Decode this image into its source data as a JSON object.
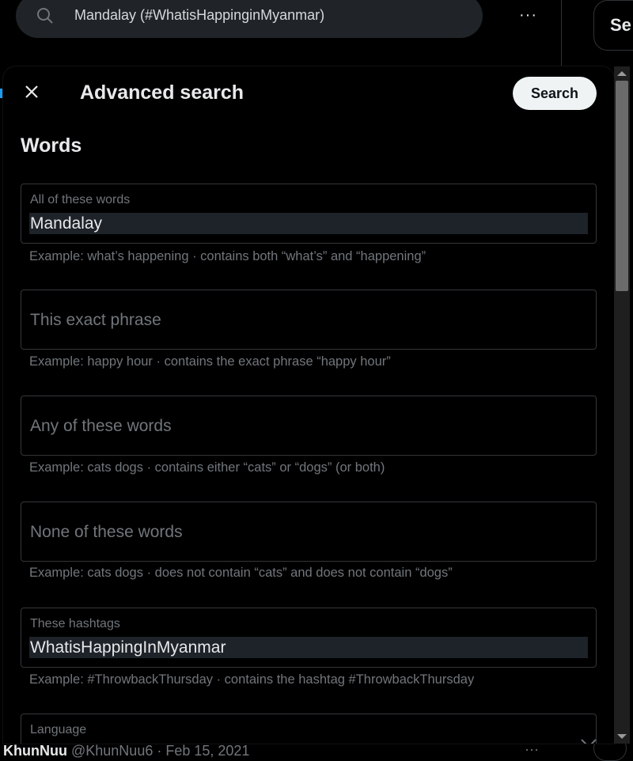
{
  "background": {
    "search_query": "Mandalay (#WhatisHappinginMyanmar)",
    "more_icon": "···",
    "right_button_label": "Se",
    "footer": {
      "name": "KhunNuu",
      "handle_date": "@KhunNuu6 · Feb 15, 2021",
      "more_icon": "···"
    }
  },
  "modal": {
    "title": "Advanced search",
    "search_button": "Search",
    "section_title": "Words",
    "fields": {
      "all_words": {
        "label": "All of these words",
        "value": "Mandalay",
        "hint": "Example: what’s happening · contains both “what’s” and “happening”"
      },
      "exact_phrase": {
        "placeholder": "This exact phrase",
        "hint": "Example: happy hour · contains the exact phrase “happy hour”"
      },
      "any_words": {
        "placeholder": "Any of these words",
        "hint": "Example: cats dogs · contains either “cats” or “dogs” (or both)"
      },
      "none_words": {
        "placeholder": "None of these words",
        "hint": "Example: cats dogs · does not contain “cats” and does not contain “dogs”"
      },
      "hashtags": {
        "label": "These hashtags",
        "value": "WhatisHappingInMyanmar",
        "hint": "Example: #ThrowbackThursday · contains the hashtag #ThrowbackThursday"
      },
      "language": {
        "label": "Language"
      }
    }
  },
  "colors": {
    "background": "#000000",
    "field_border": "#333639",
    "muted_text": "#71767b",
    "selection_bg": "#1e2229",
    "button_bg": "#eff3f4"
  }
}
